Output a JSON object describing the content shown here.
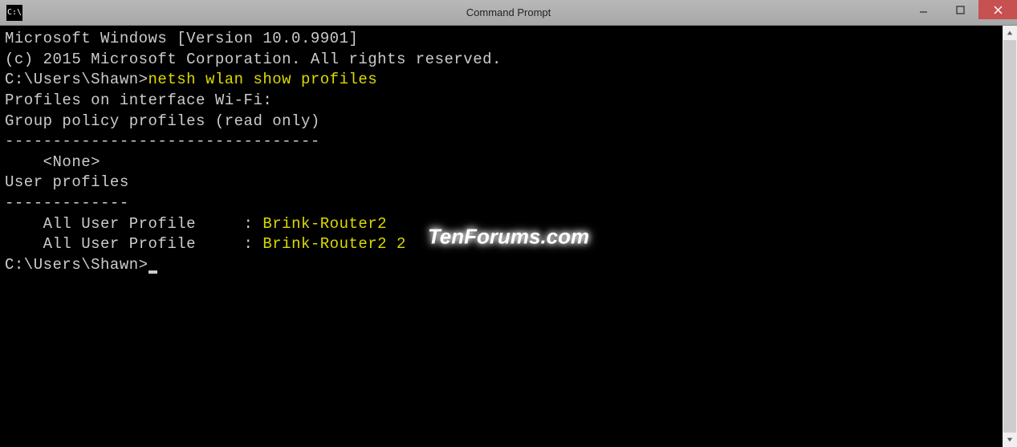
{
  "window": {
    "title": "Command Prompt"
  },
  "terminal": {
    "line1": "Microsoft Windows [Version 10.0.9901]",
    "line2": "(c) 2015 Microsoft Corporation. All rights reserved.",
    "prompt1_path": "C:\\Users\\Shawn>",
    "prompt1_cmd": "netsh wlan show profiles",
    "blank": "",
    "profiles_header": "Profiles on interface Wi-Fi:",
    "group_header": "Group policy profiles (read only)",
    "group_div": "---------------------------------",
    "group_none": "    <None>",
    "user_header": "User profiles",
    "user_div": "-------------",
    "profile1_label": "    All User Profile     : ",
    "profile1_value": "Brink-Router2",
    "profile2_label": "    All User Profile     : ",
    "profile2_value": "Brink-Router2 2",
    "prompt2_path": "C:\\Users\\Shawn>"
  },
  "watermark": "TenForums.com"
}
